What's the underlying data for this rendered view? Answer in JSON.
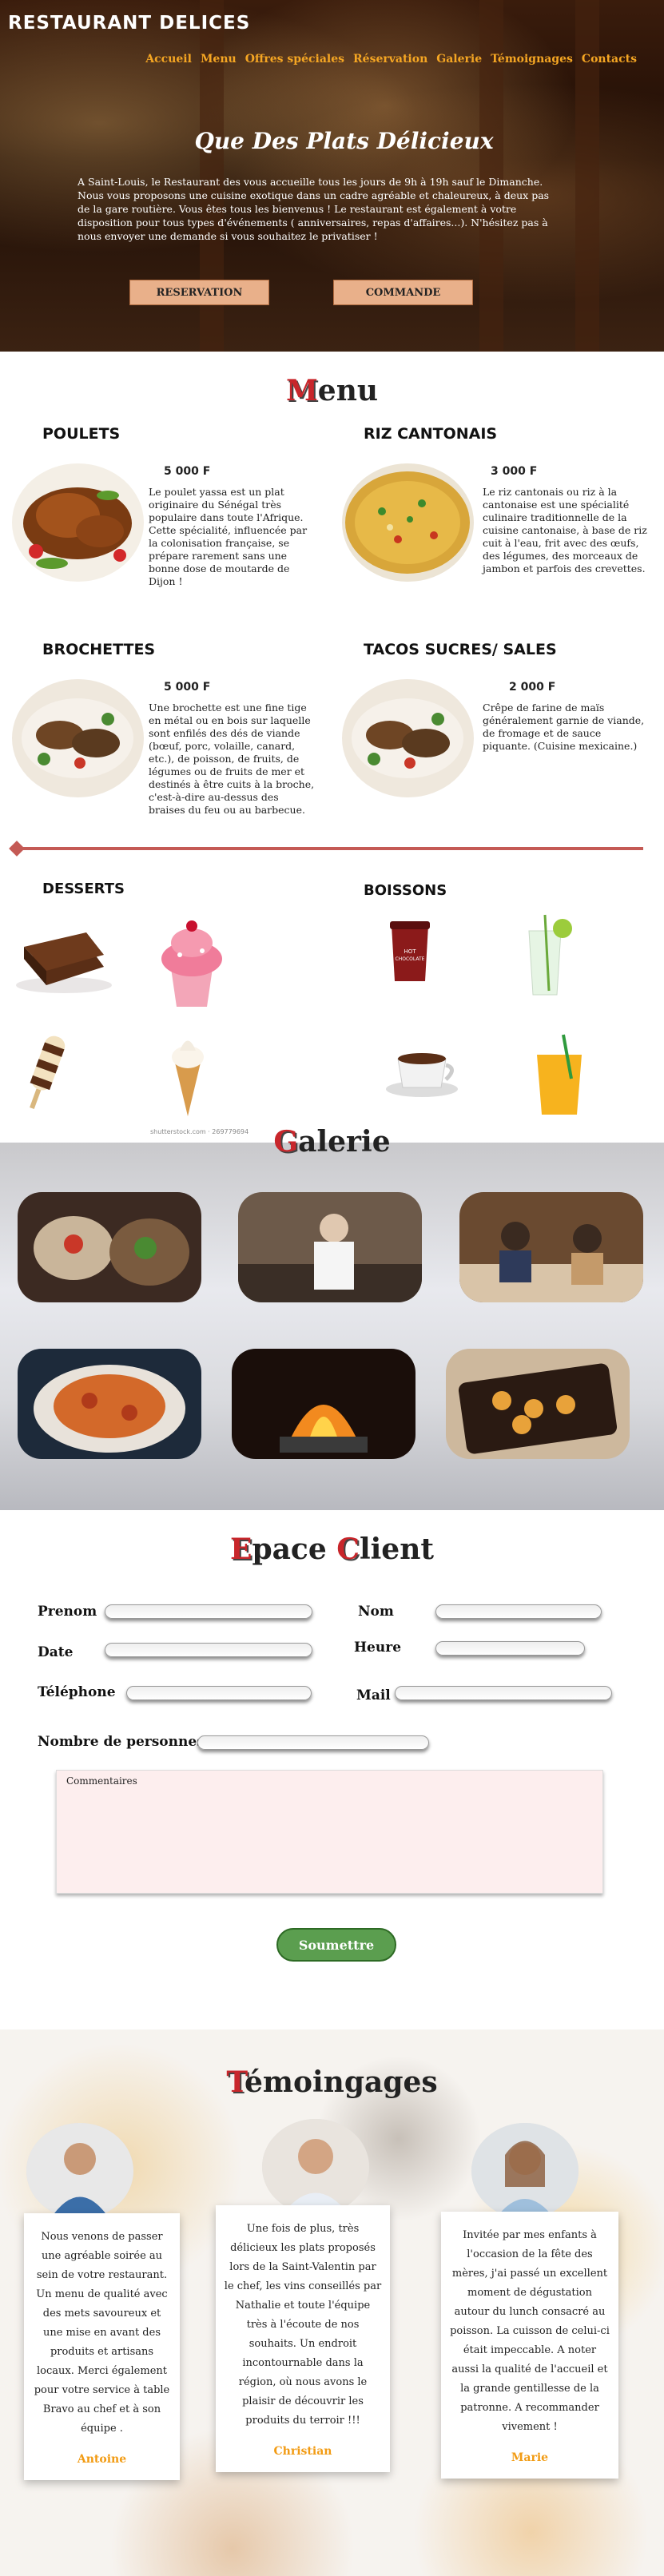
{
  "brand": "RESTAURANT DELICES",
  "nav": [
    "Accueil",
    "Menu",
    "Offres spéciales",
    "Réservation",
    "Galerie",
    "Témoignages",
    "Contacts"
  ],
  "hero": {
    "title": "Que Des Plats Délicieux",
    "text": "A Saint-Louis, le Restaurant des vous accueille tous les jours de 9h à 19h sauf le Dimanche. Nous vous proposons une cuisine exotique dans un cadre agréable et chaleureux, à deux pas de la gare routière. Vous êtes tous les bienvenus ! Le restaurant est également à votre disposition pour tous types d'événements ( anniversaires, repas d'affaires...). N'hésitez pas à nous envoyer une demande si vous souhaitez le privatiser !",
    "btn_reservation": "RESERVATION",
    "btn_commande": "COMMANDE"
  },
  "menu": {
    "title_cap": "M",
    "title_rest": "enu",
    "dishes": [
      {
        "name": "POULETS",
        "price": "5 000 F",
        "desc": "Le poulet yassa est un plat originaire du Sénégal très populaire dans toute l'Afrique. Cette spécialité, influencée par la colonisation française, se prépare rarement sans une bonne dose de moutarde de Dijon !"
      },
      {
        "name": "RIZ CANTONAIS",
        "price": "3 000 F",
        "desc": "Le riz cantonais ou riz à la cantonaise est une spécialité culinaire traditionnelle de la cuisine cantonaise, à base de riz cuit à l'eau, frit avec des œufs, des légumes, des morceaux de jambon et parfois des crevettes."
      },
      {
        "name": "BROCHETTES",
        "price": "5 000 F",
        "desc": "Une brochette est une fine tige en métal ou en bois sur laquelle sont enfilés des dés de viande (bœuf, porc, volaille, canard, etc.), de poisson, de fruits, de légumes ou de fruits de mer et destinés à être cuits à la broche, c'est-à-dire au-dessus des braises du feu ou au barbecue."
      },
      {
        "name": "TACOS SUCRES/ SALES",
        "price": "2 000 F",
        "desc": "Crêpe de farine de maïs généralement garnie de viande, de fromage et de sauce piquante. (Cuisine mexicaine.)"
      }
    ],
    "desserts_title": "DESSERTS",
    "boissons_title": "BOISSONS",
    "cup_label": "HOT CHOCOLATE",
    "credit": "shutterstock.com · 269779694"
  },
  "galerie": {
    "title_cap": "G",
    "title_rest": "alerie"
  },
  "client": {
    "title_cap1": "E",
    "title_rest1": "pace ",
    "title_cap2": "C",
    "title_rest2": "lient",
    "labels": {
      "prenom": "Prenom",
      "nom": "Nom",
      "date": "Date",
      "heure": "Heure",
      "telephone": "Téléphone",
      "mail": "Mail",
      "personnes": "Nombre de personnes"
    },
    "comment_placeholder": "Commentaires",
    "submit": "Soumettre"
  },
  "temoignages": {
    "title_cap": "T",
    "title_rest": "émoingages",
    "items": [
      {
        "text": "Nous venons de passer une agréable soirée au sein de votre restaurant. Un menu de qualité avec des mets savoureux et une mise en avant des produits et artisans locaux. Merci également pour votre service à table Bravo au chef et à son équipe .",
        "name": "Antoine"
      },
      {
        "text": "Une fois de plus, très délicieux les plats proposés lors de la Saint-Valentin par le chef, les vins conseillés par Nathalie et toute l'équipe très à l'écoute de nos souhaits. Un endroit incontournable dans la région, où nous avons le plaisir de découvrir les produits du terroir !!!",
        "name": "Christian"
      },
      {
        "text": "Invitée par mes enfants à l'occasion de la fête des mères, j'ai passé un excellent moment de dégustation autour du lunch consacré au poisson. La cuisson de celui-ci était impeccable. A noter aussi la qualité de l'accueil et la grande gentillesse de la patronne. A recommander vivement !",
        "name": "Marie"
      }
    ]
  }
}
